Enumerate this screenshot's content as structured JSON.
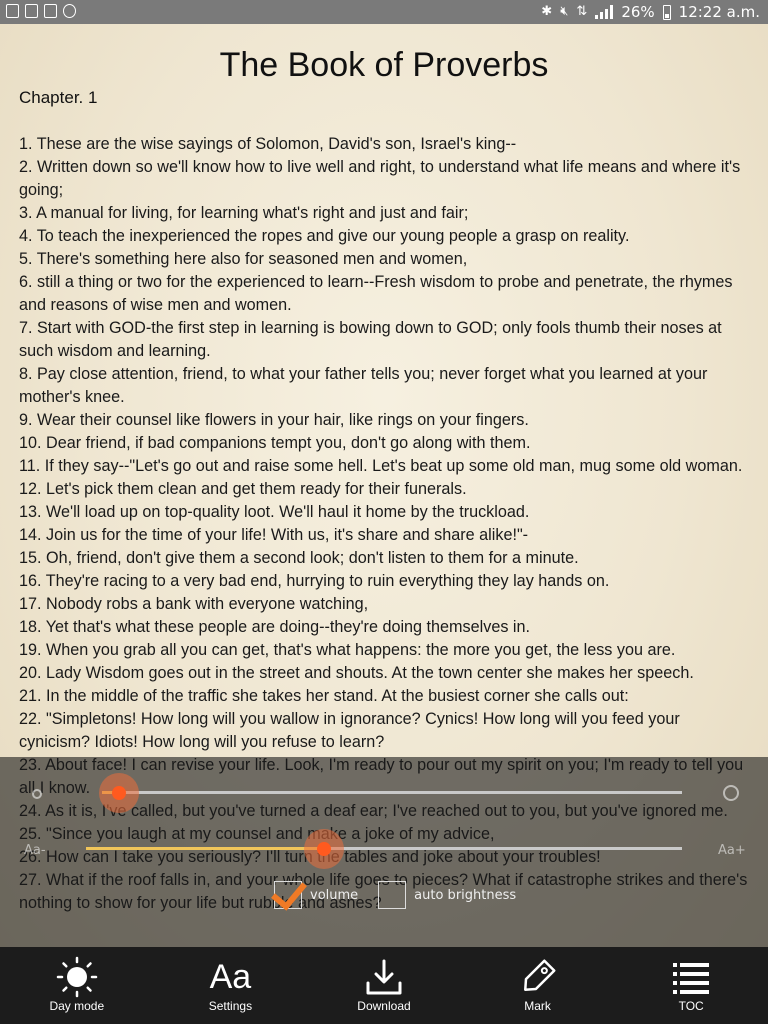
{
  "status_bar": {
    "battery": "26%",
    "time": "12:22 a.m."
  },
  "book": {
    "title": "The Book of Proverbs",
    "chapter": "Chapter. 1",
    "verses": [
      "1. These are the wise sayings of Solomon, David's son, Israel's king--",
      "2. Written down so we'll know how to live well and right, to understand what life means and where it's going;",
      "3. A manual for living, for learning what's right and just and fair;",
      "4. To teach the inexperienced the ropes and give our young people a grasp on reality.",
      "5. There's something here also for seasoned men and women,",
      "6. still a thing or two for the experienced to learn--Fresh wisdom to probe and penetrate, the rhymes and reasons of wise men and women.",
      "7. Start with GOD-the first step in learning is bowing down to GOD; only fools thumb their noses at such wisdom and learning.",
      "8. Pay close attention, friend, to what your father tells you; never forget what you learned at your mother's knee.",
      "9. Wear their counsel like flowers in your hair, like rings on your fingers.",
      "10. Dear friend, if bad companions tempt you, don't go along with them.",
      "11. If they say--\"Let's go out and raise some hell. Let's beat up some old man, mug some old woman.",
      "12. Let's pick them clean and get them ready for their funerals.",
      "13. We'll load up on top-quality loot. We'll haul it home by the truckload.",
      "14. Join us for the time of your life! With us, it's share and share alike!\"-",
      "15. Oh, friend, don't give them a second look; don't listen to them for a minute.",
      "16. They're racing to a very bad end, hurrying to ruin everything they lay hands on.",
      "17. Nobody robs a bank with everyone watching,",
      "18. Yet that's what these people are doing--they're doing themselves in.",
      "19. When you grab all you can get, that's what happens: the more you get, the less you are.",
      "20. Lady Wisdom goes out in the street and shouts. At the town center she makes her speech.",
      "21. In the middle of the traffic she takes her stand. At the busiest corner she calls out:",
      "22. \"Simpletons! How long will you wallow in ignorance? Cynics! How long will you feed your cynicism? Idiots! How long will you refuse to learn?",
      "23. About face! I can revise your life. Look, I'm ready to pour out my spirit on you; I'm ready to tell you all I know.",
      "24. As it is, I've called, but you've turned a deaf ear; I've reached out to you, but you've ignored me.",
      "25. \"Since you laugh at my counsel and make a joke of my advice,",
      "26. How can I take you seriously? I'll turn the tables and joke about your troubles!",
      "27. What if the roof falls in, and your whole life goes to pieces? What if catastrophe strikes and there's nothing to show for your life but rubble and ashes?"
    ]
  },
  "settings_panel": {
    "font_size_min_label": "Aa-",
    "font_size_max_label": "Aa+",
    "brightness_level": 0.03,
    "font_size_level": 0.4,
    "volume_label": "volume",
    "volume_checked": true,
    "auto_brightness_label": "auto brightness",
    "auto_brightness_checked": false
  },
  "bottom_nav": {
    "items": [
      {
        "label": "Day mode",
        "icon": "sun-icon"
      },
      {
        "label": "Settings",
        "icon": "font-size-icon"
      },
      {
        "label": "Download",
        "icon": "download-icon"
      },
      {
        "label": "Mark",
        "icon": "tag-icon"
      },
      {
        "label": "TOC",
        "icon": "list-icon"
      }
    ]
  },
  "colors": {
    "accent": "#ff5a1f",
    "slider_fill": "#f0c55a",
    "nav_background": "#1c1c1c"
  }
}
